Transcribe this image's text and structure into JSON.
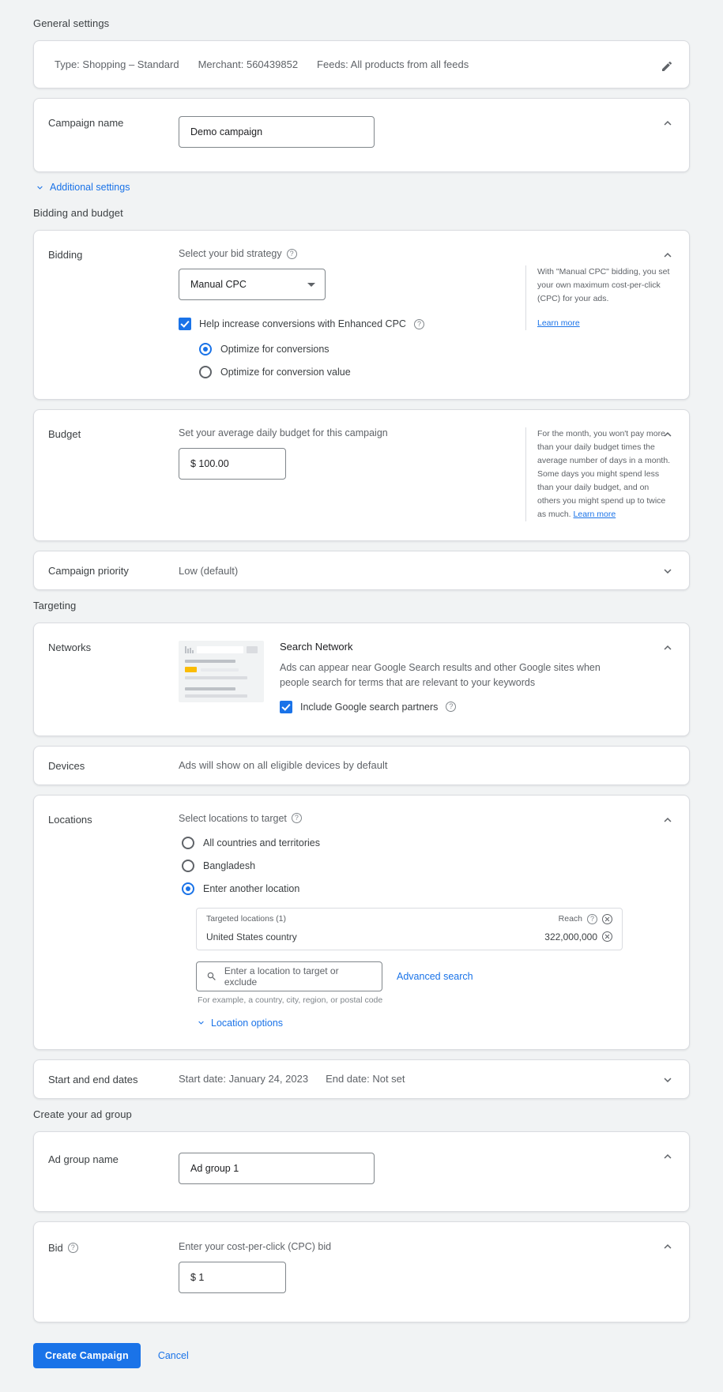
{
  "colors": {
    "accent": "#1a73e8",
    "ad_badge": "#fbbc04",
    "page_bg": "#f1f3f4",
    "card_bg": "#ffffff"
  },
  "sections": {
    "general": "General settings",
    "bidding_budget": "Bidding and budget",
    "targeting": "Targeting",
    "ad_group": "Create your ad group"
  },
  "summary": {
    "type": "Type: Shopping – Standard",
    "merchant": "Merchant: 560439852",
    "feeds": "Feeds: All products from all feeds"
  },
  "campaign_name": {
    "label": "Campaign name",
    "value": "Demo campaign"
  },
  "additional_settings": {
    "label": "Additional settings"
  },
  "bidding": {
    "label": "Bidding",
    "field_label": "Select your bid strategy",
    "strategy": "Manual CPC",
    "enhanced_cpc": "Help increase conversions with Enhanced CPC",
    "radio_conversions": "Optimize for conversions",
    "radio_conversion_value": "Optimize for conversion value",
    "aside": "With \"Manual CPC\" bidding, you set your own maximum cost-per-click (CPC) for your ads.",
    "aside_link": "Learn more"
  },
  "budget": {
    "label": "Budget",
    "field_label": "Set your average daily budget for this campaign",
    "value": "$ 100.00",
    "aside": "For the month, you won't pay more than your daily budget times the average number of days in a month. Some days you might spend less than your daily budget, and on others you might spend up to twice as much.",
    "aside_link": "Learn more"
  },
  "campaign_priority": {
    "label": "Campaign priority",
    "value": "Low (default)"
  },
  "networks": {
    "label": "Networks",
    "title": "Search Network",
    "description": "Ads can appear near Google Search results and other Google sites when people search for terms that are relevant to your keywords",
    "partners_label": "Include Google search partners"
  },
  "devices": {
    "label": "Devices",
    "value": "Ads will show on all eligible devices by default"
  },
  "locations": {
    "label": "Locations",
    "field_label": "Select locations to target",
    "radio_all": "All countries and territories",
    "radio_bangladesh": "Bangladesh",
    "radio_another": "Enter another location",
    "table_header": "Targeted locations (1)",
    "reach_header": "Reach",
    "row_name": "United States country",
    "row_reach": "322,000,000",
    "search_placeholder": "Enter a location to target or exclude",
    "advanced_search": "Advanced search",
    "hint": "For example, a country, city, region, or postal code",
    "options_link": "Location options"
  },
  "dates": {
    "label": "Start and end dates",
    "start": "Start date: January 24, 2023",
    "end": "End date: Not set"
  },
  "ad_group_name": {
    "label": "Ad group name",
    "value": "Ad group 1"
  },
  "bid": {
    "label": "Bid",
    "field_label": "Enter your cost-per-click (CPC) bid",
    "value": "$ 1"
  },
  "footer": {
    "create": "Create Campaign",
    "cancel": "Cancel"
  }
}
